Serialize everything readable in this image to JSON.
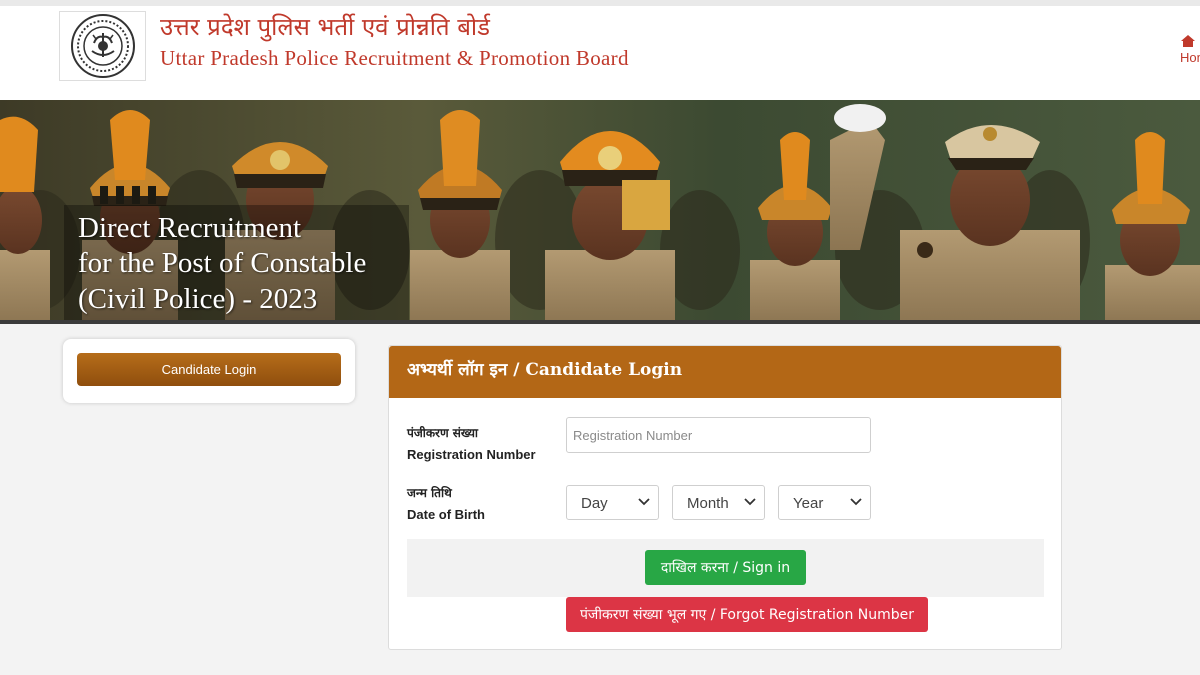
{
  "header": {
    "title_hindi": "उत्तर प्रदेश पुलिस भर्ती एवं प्रोन्नति बोर्ड",
    "title_english": "Uttar Pradesh Police Recruitment & Promotion Board",
    "home_label": "Home",
    "logo_icon": "up-police-emblem-icon",
    "accent_color": "#c0392b"
  },
  "banner": {
    "line1": "Direct Recruitment",
    "line2": "for the Post of Constable",
    "line3": "(Civil Police) - 2023"
  },
  "sidebar": {
    "login_button_label": "Candidate Login",
    "button_color": "#a35e14"
  },
  "login": {
    "title": "अभ्यर्थी लॉग इन / Candidate Login",
    "header_color": "#b36716",
    "registration": {
      "label_hindi": "पंजीकरण संख्या",
      "label_english": "Registration Number",
      "placeholder": "Registration Number",
      "value": ""
    },
    "dob": {
      "label_hindi": "जन्म तिथि",
      "label_english": "Date of Birth",
      "day": "Day",
      "month": "Month",
      "year": "Year"
    },
    "signin_label": "दाखिल करना / Sign in",
    "signin_color": "#28a745",
    "forgot_label": "पंजीकरण संख्या भूल गए / Forgot Registration Number",
    "forgot_color": "#dc3545"
  }
}
